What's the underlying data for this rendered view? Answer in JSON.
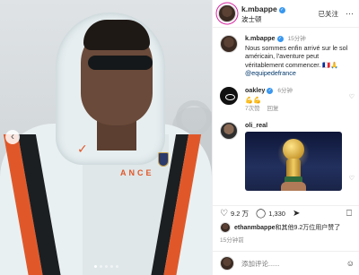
{
  "post": {
    "username": "k.mbappe",
    "location": "波士顿",
    "follow_label": "已关注",
    "more_label": "···",
    "verified_mark": "✓"
  },
  "photo": {
    "chest_text": "ANCE",
    "prev_icon": "‹",
    "carousel_dots": 5
  },
  "caption": {
    "username": "k.mbappe",
    "time": "15分钟",
    "text": "Nous sommes enfin arrivé sur le sol américain, l'aventure peut véritablement commencer. 🇫🇷🙏",
    "mention": "@equipedefrance"
  },
  "comments": [
    {
      "username": "oakley",
      "time": "6分钟",
      "text": "💪💪",
      "likes": "7次赞",
      "reply_label": "回复"
    },
    {
      "username": "oli_real",
      "time": "",
      "text": "",
      "image": "trophy"
    }
  ],
  "actions": {
    "like_count": "9.2 万",
    "comment_count": "1,330",
    "heart_icon": "♡",
    "comment_icon": "◯",
    "share_icon": "➤",
    "save_icon": "⎕"
  },
  "likes_summary": {
    "user": "ethanmbappe",
    "rest": "和其他9.2万位用户赞了"
  },
  "post_time": "15分钟前",
  "comment_input": {
    "placeholder": "添加评论......",
    "emoji_icon": "☺"
  },
  "colors": {
    "verified": "#3897f0",
    "link": "#00376b",
    "muted": "#8e8e8e",
    "accent_orange": "#e0582a"
  }
}
